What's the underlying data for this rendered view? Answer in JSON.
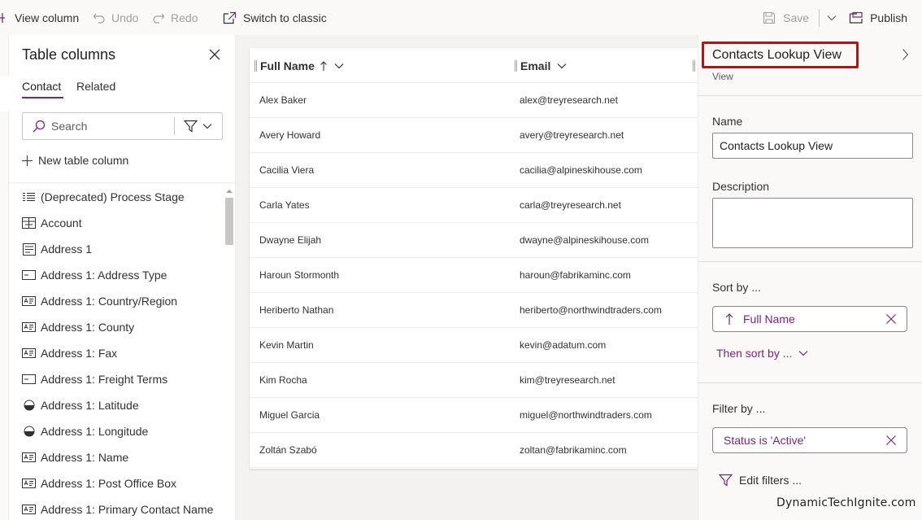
{
  "toolbar": {
    "view_column": "View column",
    "undo": "Undo",
    "redo": "Redo",
    "switch_classic": "Switch to classic",
    "save": "Save",
    "publish": "Publish"
  },
  "columns_panel": {
    "title": "Table columns",
    "tabs": [
      "Contact",
      "Related"
    ],
    "search_placeholder": "Search",
    "new_column": "New table column",
    "items": [
      {
        "label": "(Deprecated) Process Stage",
        "icon": "option-set-icon"
      },
      {
        "label": "Account",
        "icon": "lookup-icon"
      },
      {
        "label": "Address 1",
        "icon": "multiline-text-icon"
      },
      {
        "label": "Address 1: Address Type",
        "icon": "choice-icon"
      },
      {
        "label": "Address 1: Country/Region",
        "icon": "text-icon"
      },
      {
        "label": "Address 1: County",
        "icon": "text-icon"
      },
      {
        "label": "Address 1: Fax",
        "icon": "text-icon"
      },
      {
        "label": "Address 1: Freight Terms",
        "icon": "choice-icon"
      },
      {
        "label": "Address 1: Latitude",
        "icon": "floating-point-icon"
      },
      {
        "label": "Address 1: Longitude",
        "icon": "floating-point-icon"
      },
      {
        "label": "Address 1: Name",
        "icon": "text-icon"
      },
      {
        "label": "Address 1: Post Office Box",
        "icon": "text-icon"
      },
      {
        "label": "Address 1: Primary Contact Name",
        "icon": "text-icon"
      }
    ]
  },
  "grid": {
    "columns": [
      {
        "label": "Full Name",
        "sorted": "ascending"
      },
      {
        "label": "Email"
      }
    ],
    "rows": [
      {
        "name": "Alex Baker",
        "email": "alex@treyresearch.net"
      },
      {
        "name": "Avery Howard",
        "email": "avery@treyresearch.net"
      },
      {
        "name": "Cacilia Viera",
        "email": "cacilia@alpineskihouse.com"
      },
      {
        "name": "Carla Yates",
        "email": "carla@treyresearch.net"
      },
      {
        "name": "Dwayne Elijah",
        "email": "dwayne@alpineskihouse.com"
      },
      {
        "name": "Haroun Stormonth",
        "email": "haroun@fabrikaminc.com"
      },
      {
        "name": "Heriberto Nathan",
        "email": "heriberto@northwindtraders.com"
      },
      {
        "name": "Kevin Martin",
        "email": "kevin@adatum.com"
      },
      {
        "name": "Kim Rocha",
        "email": "kim@treyresearch.net"
      },
      {
        "name": "Miguel Garcia",
        "email": "miguel@northwindtraders.com"
      },
      {
        "name": "Zoltán Szabó",
        "email": "zoltan@fabrikaminc.com"
      }
    ]
  },
  "properties": {
    "title": "Contacts Lookup View",
    "subtitle": "View",
    "name_label": "Name",
    "name_value": "Contacts Lookup View",
    "description_label": "Description",
    "sort_label": "Sort by ...",
    "sort_value": "Full Name",
    "then_sort": "Then sort by ...",
    "filter_label": "Filter by ...",
    "filter_value": "Status is 'Active'",
    "edit_filters": "Edit filters ..."
  },
  "watermark": "DynamicTechIgnite.com",
  "colors": {
    "accent": "#742774",
    "highlight_box": "#e00000"
  }
}
